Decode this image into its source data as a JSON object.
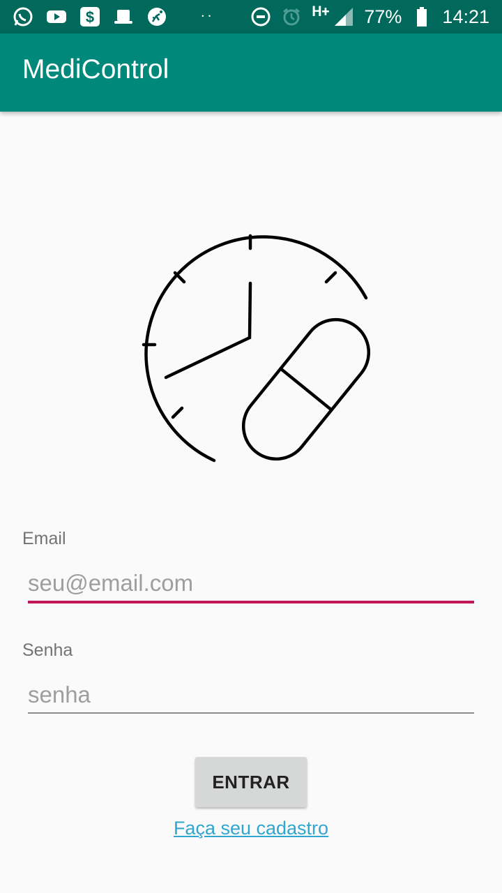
{
  "status_bar": {
    "icons": [
      "whatsapp-icon",
      "youtube-icon",
      "dollar-app-icon",
      "hat-icon",
      "soccer-app-icon",
      "dnd-icon",
      "alarm-icon",
      "signal-icon",
      "battery-icon"
    ],
    "dots": "··",
    "network": "H+",
    "battery": "77%",
    "time": "14:21"
  },
  "app_bar": {
    "title": "MediControl",
    "color": "#00897b"
  },
  "form": {
    "email_label": "Email",
    "email_placeholder": "seu@email.com",
    "password_label": "Senha",
    "password_placeholder": "senha",
    "submit_label": "ENTRAR",
    "register_link": "Faça seu cadastro"
  },
  "colors": {
    "primary": "#00897b",
    "primary_dark": "#00695c",
    "accent": "#c2185b",
    "link": "#2ea6cf"
  }
}
